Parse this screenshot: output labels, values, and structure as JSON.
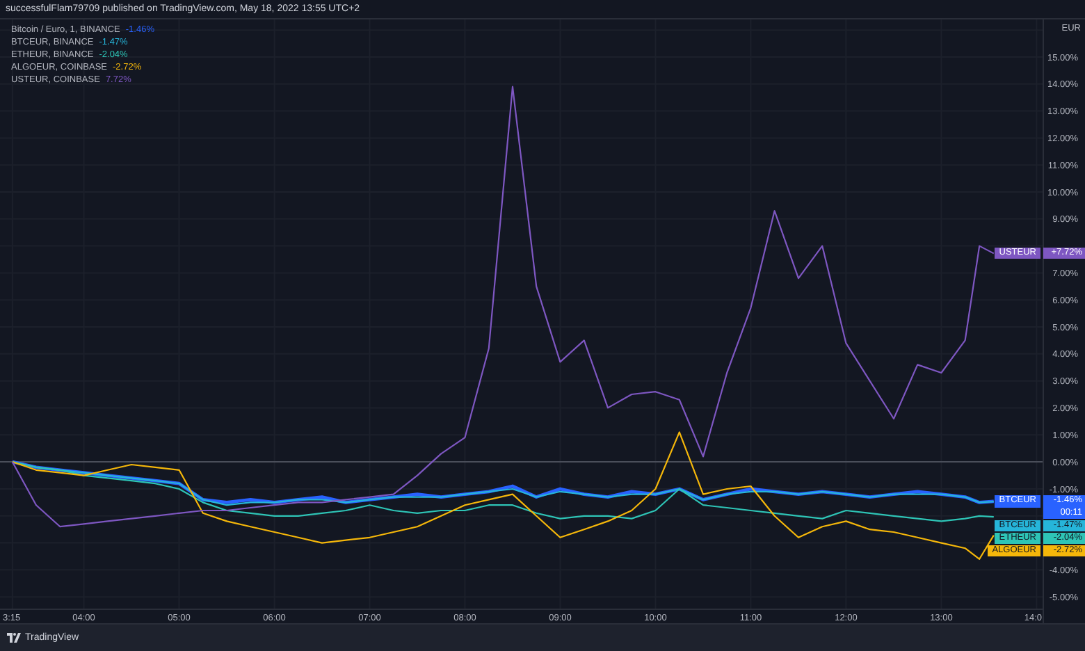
{
  "header": {
    "text": "successfulFlam79709 published on TradingView.com, May 18, 2022 13:55 UTC+2"
  },
  "chart": {
    "currency": "EUR",
    "legend_values": [
      "-1.46%",
      "-1.47%",
      "-2.04%",
      "-2.72%",
      "7.72%"
    ],
    "price_tags": [
      {
        "symbol": "USTEUR",
        "value": "+7.72%"
      },
      {
        "symbol": "BTCEUR",
        "value": "-1.46%",
        "countdown": "00:11"
      },
      {
        "symbol": "BTCEUR",
        "value": "-1.47%"
      },
      {
        "symbol": "ETHEUR",
        "value": "-2.04%"
      },
      {
        "symbol": "ALGOEUR",
        "value": "-2.72%"
      }
    ],
    "chart_data": {
      "type": "line",
      "grid": true,
      "xlim": [
        3.12,
        14.07
      ],
      "ylim": [
        -5.46,
        16.39
      ],
      "x": [
        3.25,
        3.5,
        3.75,
        4,
        4.25,
        4.5,
        4.75,
        5,
        5.25,
        5.5,
        5.75,
        6,
        6.25,
        6.5,
        6.75,
        7,
        7.25,
        7.5,
        7.75,
        8,
        8.25,
        8.5,
        8.75,
        9,
        9.25,
        9.5,
        9.75,
        10,
        10.25,
        10.5,
        10.75,
        11,
        11.25,
        11.5,
        11.75,
        12,
        12.25,
        12.5,
        12.75,
        13,
        13.25,
        13.4,
        13.55
      ],
      "xticks": [
        {
          "value": 3.25,
          "label": "3:15"
        },
        {
          "value": 4,
          "label": "04:00"
        },
        {
          "value": 5,
          "label": "05:00"
        },
        {
          "value": 6,
          "label": "06:00"
        },
        {
          "value": 7,
          "label": "07:00"
        },
        {
          "value": 8,
          "label": "08:00"
        },
        {
          "value": 9,
          "label": "09:00"
        },
        {
          "value": 10,
          "label": "10:00"
        },
        {
          "value": 11,
          "label": "11:00"
        },
        {
          "value": 12,
          "label": "12:00"
        },
        {
          "value": 13,
          "label": "13:00"
        },
        {
          "value": 14,
          "label": "14:0"
        }
      ],
      "yticks": [
        {
          "value": 15,
          "label": "15.00%"
        },
        {
          "value": 14,
          "label": "14.00%"
        },
        {
          "value": 13,
          "label": "13.00%"
        },
        {
          "value": 12,
          "label": "12.00%"
        },
        {
          "value": 11,
          "label": "11.00%"
        },
        {
          "value": 10,
          "label": "10.00%"
        },
        {
          "value": 9,
          "label": "9.00%"
        },
        {
          "value": 7,
          "label": "7.00%"
        },
        {
          "value": 6,
          "label": "6.00%"
        },
        {
          "value": 5,
          "label": "5.00%"
        },
        {
          "value": 4,
          "label": "4.00%"
        },
        {
          "value": 3,
          "label": "3.00%"
        },
        {
          "value": 2,
          "label": "2.00%"
        },
        {
          "value": 1,
          "label": "1.00%"
        },
        {
          "value": 0,
          "label": "0.00%"
        },
        {
          "value": -1,
          "label": "-1.00%"
        },
        {
          "value": -4,
          "label": "-4.00%"
        },
        {
          "value": -5,
          "label": "-5.00%"
        }
      ],
      "series": [
        {
          "name": "Bitcoin / Euro, 1, BINANCE",
          "color": "#2962ff",
          "values": [
            0,
            -0.2,
            -0.3,
            -0.4,
            -0.5,
            -0.6,
            -0.7,
            -0.8,
            -1.4,
            -1.5,
            -1.4,
            -1.5,
            -1.4,
            -1.3,
            -1.5,
            -1.4,
            -1.3,
            -1.2,
            -1.3,
            -1.2,
            -1.1,
            -0.9,
            -1.3,
            -1.0,
            -1.2,
            -1.3,
            -1.1,
            -1.2,
            -1.0,
            -1.4,
            -1.2,
            -1.0,
            -1.1,
            -1.2,
            -1.1,
            -1.2,
            -1.3,
            -1.2,
            -1.1,
            -1.2,
            -1.3,
            -1.5,
            -1.46
          ]
        },
        {
          "name": "BTCEUR, BINANCE",
          "color": "#26b5d9",
          "values": [
            0,
            -0.2,
            -0.3,
            -0.4,
            -0.5,
            -0.6,
            -0.7,
            -0.8,
            -1.4,
            -1.6,
            -1.5,
            -1.5,
            -1.4,
            -1.4,
            -1.5,
            -1.4,
            -1.3,
            -1.3,
            -1.3,
            -1.2,
            -1.1,
            -1.0,
            -1.3,
            -1.1,
            -1.2,
            -1.3,
            -1.2,
            -1.2,
            -1.0,
            -1.4,
            -1.2,
            -1.1,
            -1.1,
            -1.2,
            -1.1,
            -1.2,
            -1.3,
            -1.2,
            -1.2,
            -1.2,
            -1.3,
            -1.5,
            -1.47
          ]
        },
        {
          "name": "ETHEUR, BINANCE",
          "color": "#2ec4b6",
          "values": [
            0,
            -0.2,
            -0.3,
            -0.5,
            -0.6,
            -0.7,
            -0.8,
            -1.0,
            -1.5,
            -1.8,
            -1.9,
            -2.0,
            -2.0,
            -1.9,
            -1.8,
            -1.6,
            -1.8,
            -1.9,
            -1.8,
            -1.8,
            -1.6,
            -1.6,
            -1.9,
            -2.1,
            -2.0,
            -2.0,
            -2.1,
            -1.8,
            -1.0,
            -1.6,
            -1.7,
            -1.8,
            -1.9,
            -2.0,
            -2.1,
            -1.8,
            -1.9,
            -2.0,
            -2.1,
            -2.2,
            -2.1,
            -2.0,
            -2.04
          ]
        },
        {
          "name": "ALGOEUR, COINBASE",
          "color": "#f5b70a",
          "values": [
            0,
            -0.3,
            -0.4,
            -0.5,
            -0.3,
            -0.1,
            -0.2,
            -0.3,
            -1.9,
            -2.2,
            -2.4,
            -2.6,
            -2.8,
            -3.0,
            -2.9,
            -2.8,
            -2.6,
            -2.4,
            -2.0,
            -1.6,
            -1.4,
            -1.2,
            -2.0,
            -2.8,
            -2.5,
            -2.2,
            -1.8,
            -1.0,
            1.1,
            -1.2,
            -1.0,
            -0.9,
            -2.0,
            -2.8,
            -2.4,
            -2.2,
            -2.5,
            -2.6,
            -2.8,
            -3.0,
            -3.2,
            -3.6,
            -2.72
          ]
        },
        {
          "name": "USTEUR, COINBASE",
          "color": "#7e57c2",
          "values": [
            0,
            -1.6,
            -2.4,
            -2.3,
            -2.2,
            -2.1,
            -2.0,
            -1.9,
            -1.8,
            -1.8,
            -1.7,
            -1.6,
            -1.5,
            -1.5,
            -1.4,
            -1.3,
            -1.2,
            -0.5,
            0.3,
            0.9,
            4.2,
            13.9,
            6.5,
            3.7,
            4.5,
            2.0,
            2.5,
            2.6,
            2.3,
            0.2,
            3.3,
            5.7,
            9.3,
            6.8,
            8.0,
            4.4,
            3.0,
            1.6,
            3.6,
            3.3,
            4.5,
            8.0,
            7.72
          ]
        }
      ]
    }
  },
  "footer": {
    "brand": "TradingView"
  }
}
